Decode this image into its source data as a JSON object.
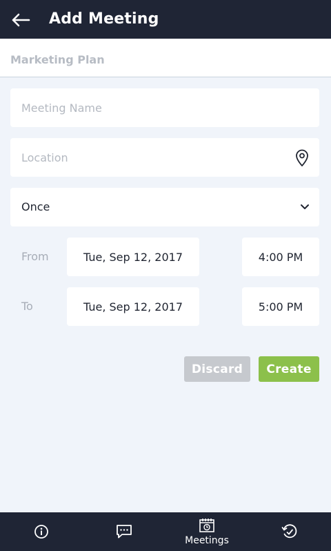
{
  "header": {
    "title": "Add Meeting",
    "back_icon": "arrow-left-icon"
  },
  "subheader": {
    "label": "Marketing Plan"
  },
  "form": {
    "meeting_name": {
      "value": "",
      "placeholder": "Meeting Name"
    },
    "location": {
      "value": "",
      "placeholder": "Location",
      "icon": "location-pin-icon"
    },
    "recurrence": {
      "value": "Once",
      "icon": "chevron-down-icon"
    },
    "from": {
      "label": "From",
      "date": "Tue, Sep 12, 2017",
      "time": "4:00 PM"
    },
    "to": {
      "label": "To",
      "date": "Tue, Sep 12, 2017",
      "time": "5:00 PM"
    }
  },
  "actions": {
    "discard_label": "Discard",
    "create_label": "Create"
  },
  "tabs": [
    {
      "icon": "info-icon",
      "label": ""
    },
    {
      "icon": "chat-icon",
      "label": ""
    },
    {
      "icon": "meetings-icon",
      "label": "Meetings"
    },
    {
      "icon": "history-icon",
      "label": ""
    }
  ],
  "colors": {
    "header_bg": "#1f2535",
    "page_bg": "#f0f4fa",
    "create_button": "#8cc04b",
    "discard_button": "#c6c9ce",
    "muted_text": "#a7adb7"
  }
}
